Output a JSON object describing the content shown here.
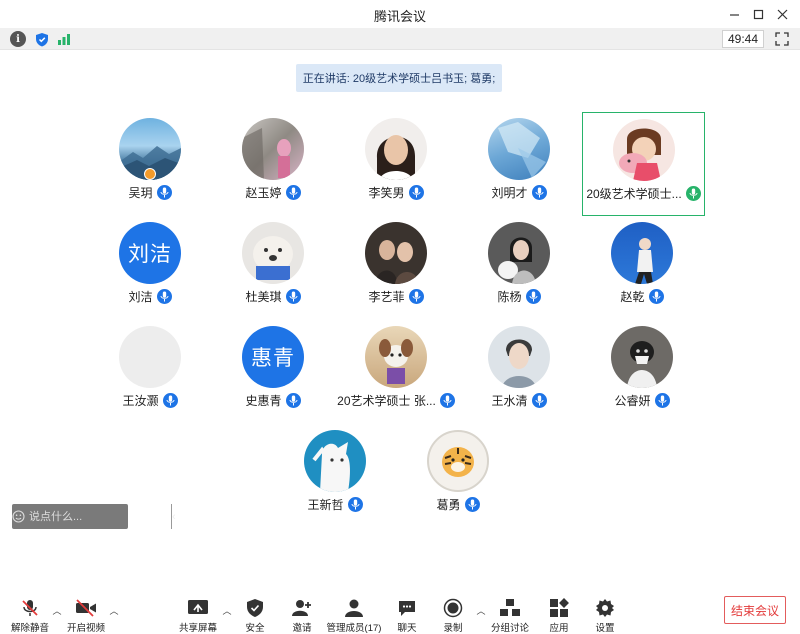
{
  "window": {
    "title": "腾讯会议",
    "timer": "49:44"
  },
  "banner": {
    "speaking": "正在讲话: 20级艺术学硕士吕书玉; 葛勇;"
  },
  "participants": [
    {
      "name": "吴玥",
      "avatar_text": "",
      "mic": "blue"
    },
    {
      "name": "赵玉婷",
      "avatar_text": "",
      "mic": "blue"
    },
    {
      "name": "李笑男",
      "avatar_text": "",
      "mic": "blue"
    },
    {
      "name": "刘明才",
      "avatar_text": "",
      "mic": "blue"
    },
    {
      "name": "20级艺术学硕士...",
      "avatar_text": "",
      "mic": "green"
    },
    {
      "name": "刘洁",
      "avatar_text": "刘洁",
      "mic": "blue"
    },
    {
      "name": "杜美琪",
      "avatar_text": "",
      "mic": "blue"
    },
    {
      "name": "李艺菲",
      "avatar_text": "",
      "mic": "blue"
    },
    {
      "name": "陈杨",
      "avatar_text": "",
      "mic": "blue"
    },
    {
      "name": "赵乾",
      "avatar_text": "",
      "mic": "blue"
    },
    {
      "name": "王汝灏",
      "avatar_text": "",
      "mic": "blue"
    },
    {
      "name": "史惠青",
      "avatar_text": "惠青",
      "mic": "blue"
    },
    {
      "name": "20艺术学硕士 张...",
      "avatar_text": "",
      "mic": "blue"
    },
    {
      "name": "王水清",
      "avatar_text": "",
      "mic": "blue"
    },
    {
      "name": "公睿妍",
      "avatar_text": "",
      "mic": "blue"
    },
    {
      "name": "王新哲",
      "avatar_text": "",
      "mic": "blue"
    },
    {
      "name": "葛勇",
      "avatar_text": "",
      "mic": "blue"
    }
  ],
  "chat": {
    "placeholder": "说点什么..."
  },
  "toolbar": {
    "unmute": "解除静音",
    "start_video": "开启视频",
    "share_screen": "共享屏幕",
    "security": "安全",
    "invite": "邀请",
    "manage_members": "管理成员(17)",
    "chat": "聊天",
    "record": "录制",
    "breakout": "分组讨论",
    "apps": "应用",
    "settings": "设置",
    "end_meeting": "结束会议"
  },
  "colors": {
    "accent": "#1e74e6",
    "speaking_green": "#27b36a",
    "banner_bg": "#dbe8f7",
    "danger": "#e33b3b"
  }
}
